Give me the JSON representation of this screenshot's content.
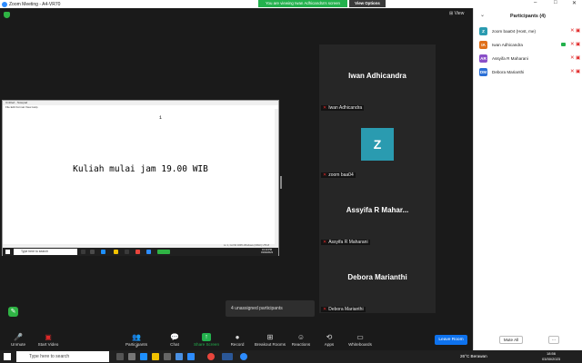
{
  "window": {
    "title": "Zoom Meeting - A4-VR70",
    "minimize": "–",
    "maximize": "□",
    "close": "✕"
  },
  "banner": {
    "share_text": "You are viewing Iwan Adhicandra's screen",
    "view_options": "View Options"
  },
  "meeting": {
    "view_label": "⊞ View"
  },
  "shared_screen": {
    "app_title": "Untitled - Notepad",
    "menu": "File  Edit  Format  View  Help",
    "cursor_line": "1",
    "text": "Kuliah mulai jam 19.00 WIB",
    "status": "Ln 1, Col 62        100%      Windows (CRLF)      UTF-8",
    "search_placeholder": "Type here to search",
    "clock_time": "19:19 PM",
    "clock_date": "03/30/2023"
  },
  "tiles": [
    {
      "display_name": "Iwan Adhicandra",
      "label": "Iwan Adhicandra",
      "avatar": ""
    },
    {
      "display_name": "",
      "label": "zoom baa04",
      "avatar": "Z"
    },
    {
      "display_name": "Assyifa R Mahar...",
      "label": "Assyifa R Maharani",
      "avatar": ""
    },
    {
      "display_name": "Debora Marianthi",
      "label": "Debora Marianthi",
      "avatar": ""
    }
  ],
  "unassigned": "4 unassigned participants",
  "toolbar": {
    "unmute": "Unmute",
    "start_video": "Start Video",
    "participants": "Participants",
    "participants_count": "4",
    "chat": "Chat",
    "share_screen": "Share Screen",
    "record": "Record",
    "breakout_rooms": "Breakout Rooms",
    "reactions": "Reactions",
    "apps": "Apps",
    "whiteboards": "Whiteboards",
    "leave": "Leave Room"
  },
  "panel": {
    "title": "Participants (4)",
    "participants": [
      {
        "initials": "Z",
        "name": "zoom baa04 (Host, me)",
        "color": "#2a9bb0"
      },
      {
        "initials": "IA",
        "name": "Iwan Adhicandra",
        "color": "#e0701a"
      },
      {
        "initials": "AR",
        "name": "Assyifa R Maharani",
        "color": "#8a4fc8"
      },
      {
        "initials": "DM",
        "name": "Debora Marianthi",
        "color": "#2a6fd6"
      }
    ],
    "mute_all": "Mute All",
    "more": "..."
  },
  "taskbar": {
    "search_placeholder": "Type here to search",
    "weather": "26°C  Berawan",
    "time": "18:56",
    "date": "03/30/2023"
  }
}
